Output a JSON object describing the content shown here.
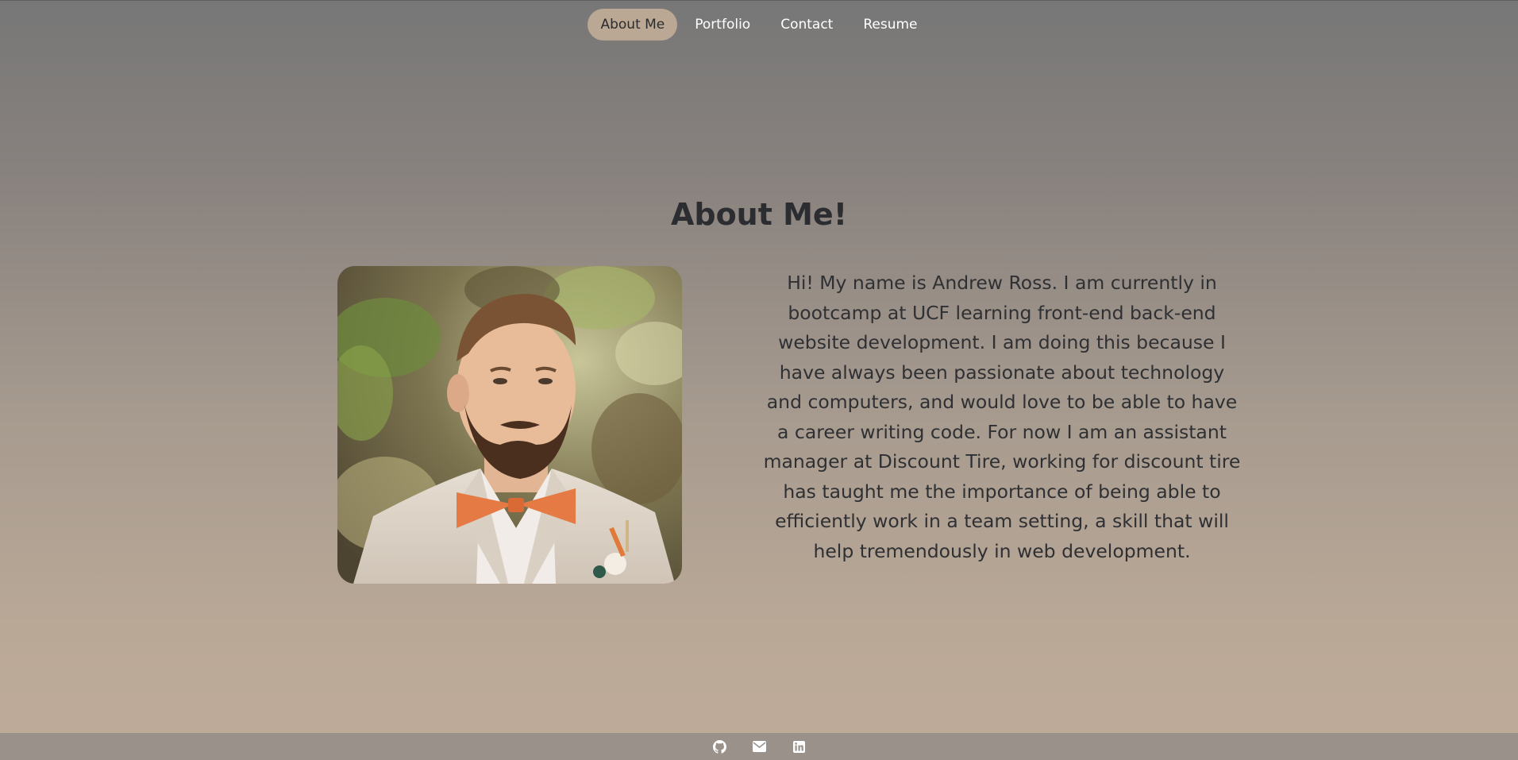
{
  "nav": {
    "items": [
      {
        "label": "About Me",
        "active": true
      },
      {
        "label": "Portfolio",
        "active": false
      },
      {
        "label": "Contact",
        "active": false
      },
      {
        "label": "Resume",
        "active": false
      }
    ]
  },
  "about": {
    "title": "About Me!",
    "bio": "Hi! My name is Andrew Ross. I am currently in bootcamp at UCF learning front-end back-end website development. I am doing this because I have always been passionate about technology and computers, and would love to be able to have a career writing code. For now I am an assistant manager at Discount Tire, working for discount tire has taught me the importance of being able to efficiently work in a team setting, a skill that will help tremendously in web development."
  },
  "footer": {
    "icons": [
      "github-icon",
      "envelope-icon",
      "linkedin-icon"
    ]
  },
  "colors": {
    "nav_active_bg": "#bba894",
    "footer_bg": "#99918a",
    "tie": "#e57a45",
    "suit": "#e0d6cb"
  }
}
